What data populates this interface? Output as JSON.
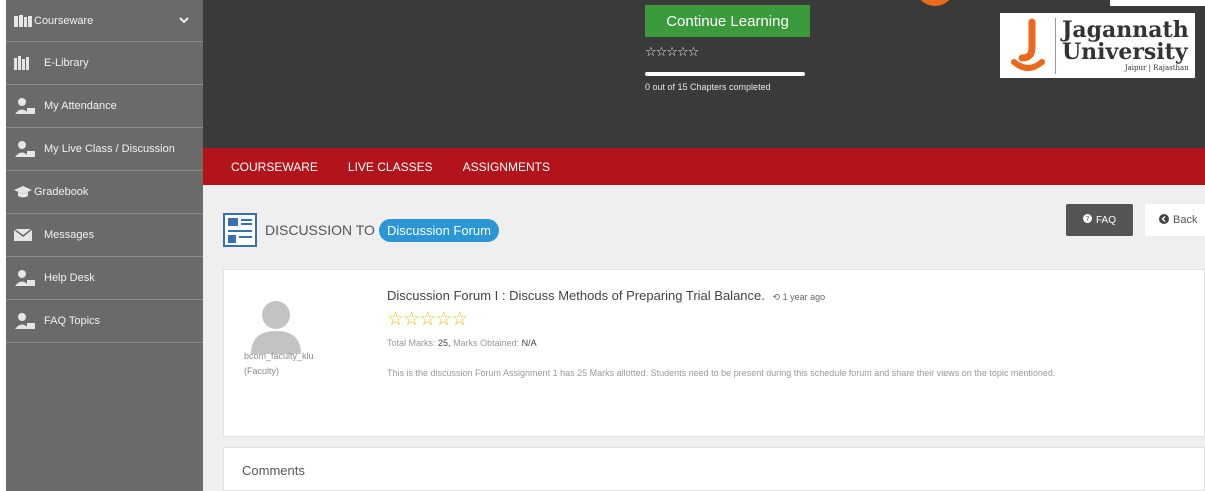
{
  "sidebar": {
    "items": [
      {
        "label": "Courseware",
        "icon": "books-icon"
      },
      {
        "label": "E-Library",
        "icon": "library-icon"
      },
      {
        "label": "My Attendance",
        "icon": "user-attendance-icon"
      },
      {
        "label": "My Live Class / Discussion",
        "icon": "user-class-icon"
      },
      {
        "label": "Gradebook",
        "icon": "graduation-cap-icon"
      },
      {
        "label": "Messages",
        "icon": "envelope-icon"
      },
      {
        "label": "Help Desk",
        "icon": "user-help-icon"
      },
      {
        "label": "FAQ Topics",
        "icon": "user-faq-icon"
      }
    ]
  },
  "header": {
    "continue_label": "Continue Learning",
    "rating_stars": "☆☆☆☆☆",
    "progress_fraction": 0.0,
    "progress_text": "0 out of 15 Chapters completed",
    "logo": {
      "line1": "Jagannath",
      "line2": "University",
      "sub": "Jaipur | Rajasthan"
    }
  },
  "nav": {
    "courseware": "COURSEWARE",
    "live_classes": "LIVE CLASSES",
    "assignments": "ASSIGNMENTS"
  },
  "discussion": {
    "title_prefix": "DISCUSSION TO",
    "forum_pill": "Discussion Forum",
    "faq_label": "FAQ",
    "back_label": "Back",
    "post": {
      "title": "Discussion Forum I : Discuss Methods of Preparing Trial Balance.",
      "time": "1 year ago",
      "stars": "☆☆☆☆☆",
      "author": "bcom_faculty_klu",
      "role": "(Faculty)",
      "total_marks_label": "Total Marks:",
      "total_marks_value": "25,",
      "marks_obtained_label": "Marks Obtained:",
      "marks_obtained_value": "N/A",
      "body": "This is the discussion Forum Assignment 1 has 25 Marks allotted. Students need to be present during this schedule forum and share their views on the topic mentioned."
    },
    "comments_label": "Comments"
  },
  "colors": {
    "sidebar_bg": "#6a6a6a",
    "header_bg": "#3a3a3a",
    "nav_red": "#b2141c",
    "green": "#3a9a3c",
    "pill_blue": "#2a96d6",
    "star_gold": "#e8c41a",
    "logo_orange": "#e96a1f"
  }
}
